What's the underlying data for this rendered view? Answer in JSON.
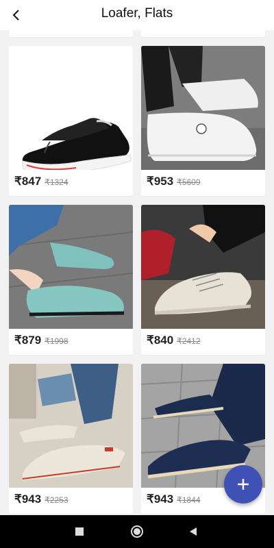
{
  "header": {
    "title": "Loafer, Flats",
    "back_icon": "arrow-left-icon"
  },
  "products": [
    {
      "price": "₹847",
      "mrp": "₹1324",
      "image": "black-slip-on-sneaker"
    },
    {
      "price": "₹953",
      "mrp": "₹5609",
      "image": "white-smiley-slip-on"
    },
    {
      "price": "₹879",
      "mrp": "₹1998",
      "image": "teal-knit-loafer"
    },
    {
      "price": "₹840",
      "mrp": "₹2412",
      "image": "cream-lace-up-sneaker"
    },
    {
      "price": "₹943",
      "mrp": "₹2253",
      "image": "beige-linen-loafer"
    },
    {
      "price": "₹943",
      "mrp": "₹1844",
      "image": "navy-canvas-loafer"
    }
  ],
  "fab": {
    "icon": "plus-icon"
  },
  "navigation": {
    "icons": [
      "recents-square-icon",
      "home-circle-icon",
      "back-triangle-icon"
    ]
  },
  "colors": {
    "accent": "#3f51b5",
    "background": "#f2f2f2"
  }
}
